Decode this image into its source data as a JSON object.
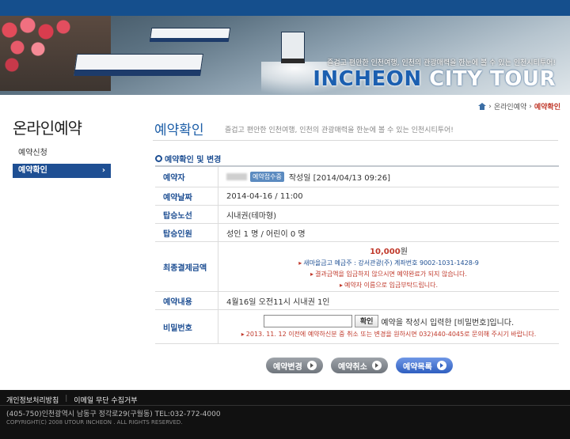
{
  "banner": {
    "slogan": "즐겁고 편안한 인천여행, 인천의 관광매력을 한눈에 볼 수 있는 인천시티투어!",
    "brand_part1": "INCHEON",
    "brand_part2": "CITY TOUR"
  },
  "breadcrumb": {
    "parent": "온라인예약",
    "current": "예약확인"
  },
  "sidebar": {
    "title": "온라인예약",
    "items": [
      {
        "label": "예약신청"
      },
      {
        "label": "예약확인",
        "arrow": "›"
      }
    ]
  },
  "main": {
    "title": "예약확인",
    "subtitle": "즐겁고 편안한 인천여행, 인천의 관광매력을 한눈에 볼 수 있는 인천시티투어!",
    "section_title": "예약확인 및 변경"
  },
  "reservation": {
    "reserver_label": "예약자",
    "status_badge": "예약접수중",
    "created_at": "작성일 [2014/04/13 09:26]",
    "date_label": "예약날짜",
    "date_value": "2014-04-16 / 11:00",
    "route_label": "탑승노선",
    "route_value": "시내권(테마형)",
    "people_label": "탑승인원",
    "people_value": "성인 1 명 / 어린이 0 명",
    "payment_label": "최종결제금액",
    "amount": "10,000",
    "amount_unit": "원",
    "account_note": "새마을금고 예금주 : 강서관광(주) 계좌번호 9002-1031-1428-9",
    "deposit_warning": "결과금액을 입금하지 않으시면 예약완료가 되지 않습니다.",
    "name_warning": "예약자 이름으로 입금부탁드립니다.",
    "content_label": "예약내용",
    "content_value": "4월16일 오전11시 시내권 1인",
    "password_label": "비밀번호",
    "password_button": "확인",
    "password_hint": "예약을 작성시 입력한 [비밀번호]입니다.",
    "cancel_note": "2013. 11. 12 이전에 예약하신분 중 취소 또는 변경을 원하시면 032)440-4045로 문의해 주시기 바랍니다."
  },
  "actions": {
    "change": "예약변경",
    "cancel": "예약취소",
    "list": "예약목록"
  },
  "footer": {
    "privacy": "개인정보처리방침",
    "sep": "|",
    "email": "이메일 무단 수집거부",
    "address": "(405-750)인천광역시 남동구 정각로29(구월동) TEL:032-772-4000",
    "copyright": "COPYRIGHT(C) 2008 UTOUR INCHEON . ALL RIGHTS RESERVED."
  },
  "colors": {
    "accent_blue": "#1e4f93",
    "warning_red": "#c0392b"
  }
}
